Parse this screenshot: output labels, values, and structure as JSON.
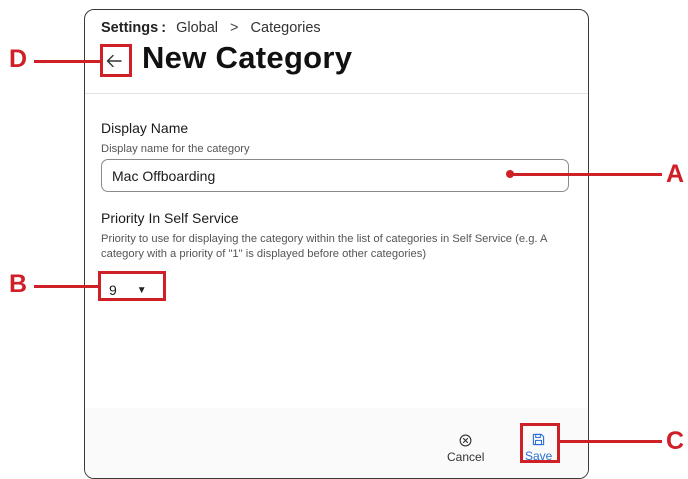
{
  "breadcrumb": {
    "root": "Settings",
    "colon": ":",
    "section": "Global",
    "separator": ">",
    "page": "Categories"
  },
  "header": {
    "title": "New Category",
    "back_icon": "arrow-left-icon"
  },
  "form": {
    "display_name": {
      "label": "Display Name",
      "help": "Display name for the category",
      "value": "Mac Offboarding"
    },
    "priority": {
      "label": "Priority In Self Service",
      "help": "Priority to use for displaying the category within the list of categories in Self Service (e.g. A category with a priority of \"1\" is displayed before other categories)",
      "value": "9"
    }
  },
  "footer": {
    "cancel_label": "Cancel",
    "cancel_icon": "close-circle-icon",
    "save_label": "Save",
    "save_icon": "floppy-disk-icon"
  },
  "annotations": {
    "color": "#cf2027",
    "labels": {
      "a": "A",
      "b": "B",
      "c": "C",
      "d": "D"
    }
  },
  "colors": {
    "accent": "#2a6fd6",
    "border": "#3a3a3a"
  }
}
